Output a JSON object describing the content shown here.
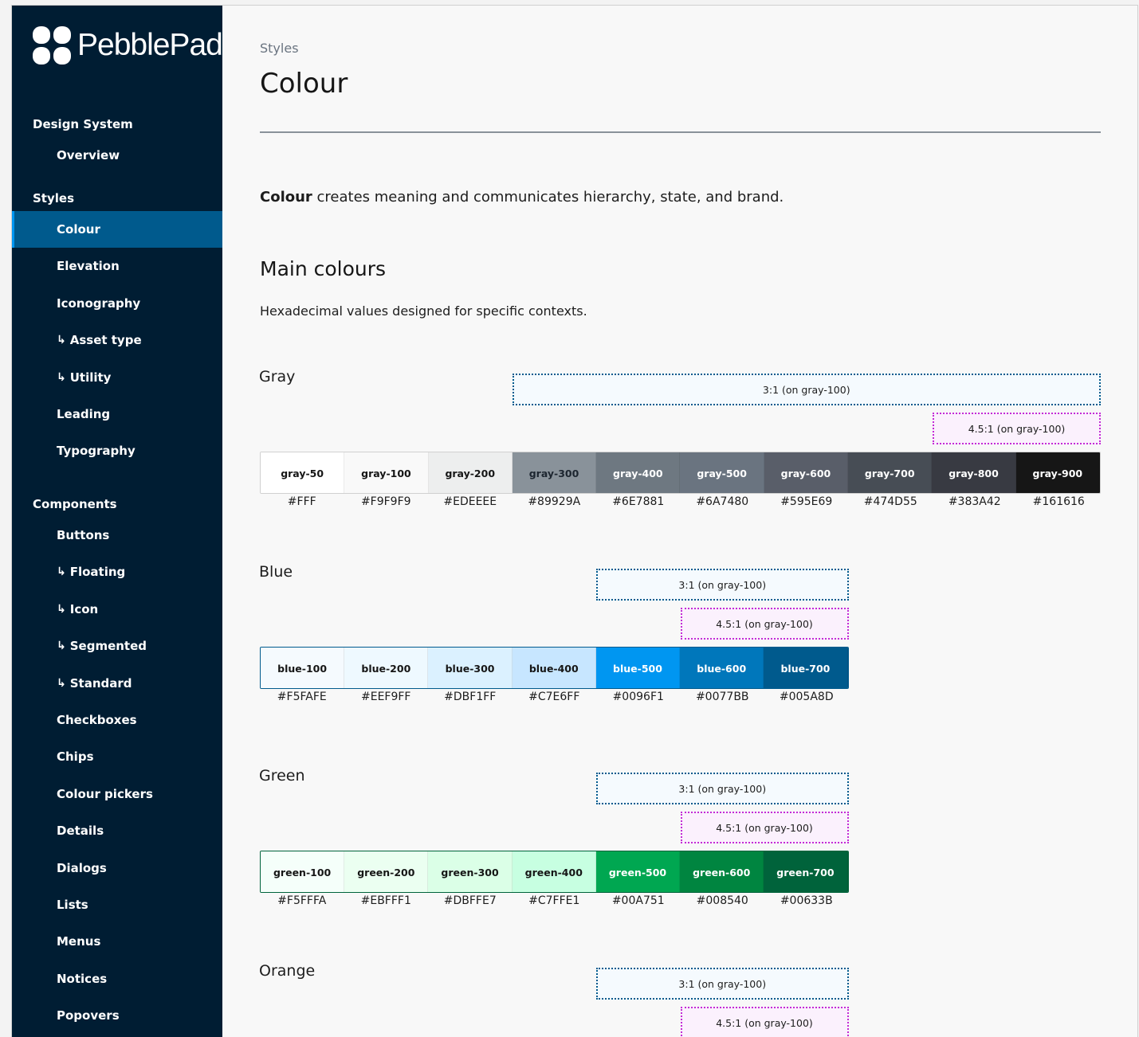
{
  "brand": {
    "name": "PebblePad",
    "logo_icon": "pebblepad-logo-icon"
  },
  "sidebar": {
    "sections": [
      {
        "label": "Design System",
        "items": [
          {
            "label": "Overview",
            "sub": false
          }
        ]
      },
      {
        "label": "Styles",
        "items": [
          {
            "label": "Colour",
            "sub": false,
            "active": true
          },
          {
            "label": "Elevation",
            "sub": false
          },
          {
            "label": "Iconography",
            "sub": false
          },
          {
            "label": "Asset type",
            "sub": true
          },
          {
            "label": "Utility",
            "sub": true
          },
          {
            "label": "Leading",
            "sub": false
          },
          {
            "label": "Typography",
            "sub": false
          }
        ]
      },
      {
        "label": "Components",
        "items": [
          {
            "label": "Buttons",
            "sub": false
          },
          {
            "label": "Floating",
            "sub": true
          },
          {
            "label": "Icon",
            "sub": true
          },
          {
            "label": "Segmented",
            "sub": true
          },
          {
            "label": "Standard",
            "sub": true
          },
          {
            "label": "Checkboxes",
            "sub": false
          },
          {
            "label": "Chips",
            "sub": false
          },
          {
            "label": "Colour pickers",
            "sub": false
          },
          {
            "label": "Details",
            "sub": false
          },
          {
            "label": "Dialogs",
            "sub": false
          },
          {
            "label": "Lists",
            "sub": false
          },
          {
            "label": "Menus",
            "sub": false
          },
          {
            "label": "Notices",
            "sub": false
          },
          {
            "label": "Popovers",
            "sub": false
          }
        ]
      }
    ],
    "sub_arrow": "↳"
  },
  "page": {
    "breadcrumb": "Styles",
    "title": "Colour",
    "intro_bold": "Colour",
    "intro_rest": " creates meaning and communicates hierarchy, state, and brand.",
    "main_heading": "Main colours",
    "main_sub": "Hexadecimal values designed for specific contexts."
  },
  "palettes": [
    {
      "name": "Gray",
      "ratio_3": "3:1 (on gray-100)",
      "ratio_45": "4.5:1 (on gray-100)",
      "swatches": [
        {
          "name": "gray-50",
          "hex": "#FFF",
          "color": "#FFFFFF",
          "text": "#161616"
        },
        {
          "name": "gray-100",
          "hex": "#F9F9F9",
          "color": "#F9F9F9",
          "text": "#161616"
        },
        {
          "name": "gray-200",
          "hex": "#EDEEEE",
          "color": "#EDEEEE",
          "text": "#161616"
        },
        {
          "name": "gray-300",
          "hex": "#89929A",
          "color": "#89929A",
          "text": "#1d2630"
        },
        {
          "name": "gray-400",
          "hex": "#6E7881",
          "color": "#6E7881",
          "text": "#FFFFFF"
        },
        {
          "name": "gray-500",
          "hex": "#6A7480",
          "color": "#6A7480",
          "text": "#FFFFFF"
        },
        {
          "name": "gray-600",
          "hex": "#595E69",
          "color": "#595E69",
          "text": "#FFFFFF"
        },
        {
          "name": "gray-700",
          "hex": "#474D55",
          "color": "#474D55",
          "text": "#FFFFFF"
        },
        {
          "name": "gray-800",
          "hex": "#383A42",
          "color": "#383A42",
          "text": "#FFFFFF"
        },
        {
          "name": "gray-900",
          "hex": "#161616",
          "color": "#161616",
          "text": "#FFFFFF"
        }
      ]
    },
    {
      "name": "Blue",
      "ratio_3": "3:1 (on gray-100)",
      "ratio_45": "4.5:1 (on gray-100)",
      "swatches": [
        {
          "name": "blue-100",
          "hex": "#F5FAFE",
          "color": "#F5FAFE",
          "text": "#161616"
        },
        {
          "name": "blue-200",
          "hex": "#EEF9FF",
          "color": "#EEF9FF",
          "text": "#161616"
        },
        {
          "name": "blue-300",
          "hex": "#DBF1FF",
          "color": "#DBF1FF",
          "text": "#161616"
        },
        {
          "name": "blue-400",
          "hex": "#C7E6FF",
          "color": "#C7E6FF",
          "text": "#161616"
        },
        {
          "name": "blue-500",
          "hex": "#0096F1",
          "color": "#0096F1",
          "text": "#FFFFFF"
        },
        {
          "name": "blue-600",
          "hex": "#0077BB",
          "color": "#0077BB",
          "text": "#FFFFFF"
        },
        {
          "name": "blue-700",
          "hex": "#005A8D",
          "color": "#005A8D",
          "text": "#FFFFFF"
        }
      ]
    },
    {
      "name": "Green",
      "ratio_3": "3:1 (on gray-100)",
      "ratio_45": "4.5:1 (on gray-100)",
      "swatches": [
        {
          "name": "green-100",
          "hex": "#F5FFFA",
          "color": "#F5FFFA",
          "text": "#161616"
        },
        {
          "name": "green-200",
          "hex": "#EBFFF1",
          "color": "#EBFFF1",
          "text": "#161616"
        },
        {
          "name": "green-300",
          "hex": "#DBFFE7",
          "color": "#DBFFE7",
          "text": "#161616"
        },
        {
          "name": "green-400",
          "hex": "#C7FFE1",
          "color": "#C7FFE1",
          "text": "#161616"
        },
        {
          "name": "green-500",
          "hex": "#00A751",
          "color": "#00A751",
          "text": "#FFFFFF"
        },
        {
          "name": "green-600",
          "hex": "#008540",
          "color": "#008540",
          "text": "#FFFFFF"
        },
        {
          "name": "green-700",
          "hex": "#00633B",
          "color": "#00633B",
          "text": "#FFFFFF"
        }
      ]
    },
    {
      "name": "Orange",
      "ratio_3": "3:1 (on gray-100)",
      "ratio_45": "4.5:1 (on gray-100)",
      "swatches": []
    }
  ]
}
